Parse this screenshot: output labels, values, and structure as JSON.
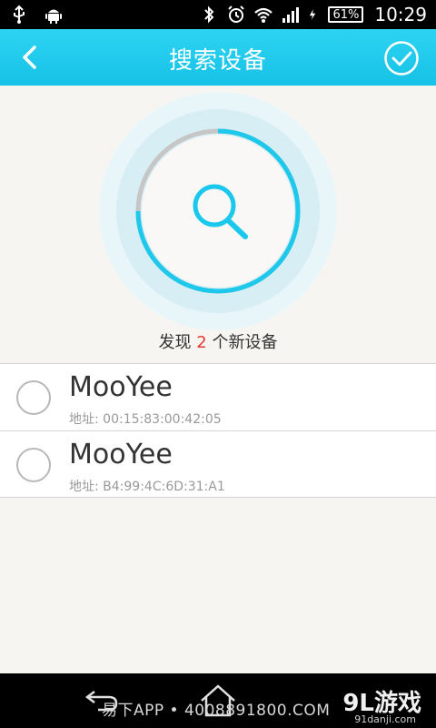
{
  "status_bar": {
    "battery": "61%",
    "time": "10:29"
  },
  "header": {
    "title": "搜索设备"
  },
  "scan": {
    "progress": 0.75
  },
  "found": {
    "prefix": "发现",
    "count": "2",
    "suffix": "个新设备"
  },
  "devices": [
    {
      "name": "MooYee",
      "address": "地址: 00:15:83:00:42:05",
      "selected": false
    },
    {
      "name": "MooYee",
      "address": "地址: B4:99:4C:6D:31:A1",
      "selected": false
    }
  ],
  "watermark": {
    "text": "易下APP • 4008891800.COM",
    "logo": "9L游戏",
    "site": "91danji.com"
  },
  "colors": {
    "accent": "#1ec8ea",
    "count_red": "#e53935"
  }
}
